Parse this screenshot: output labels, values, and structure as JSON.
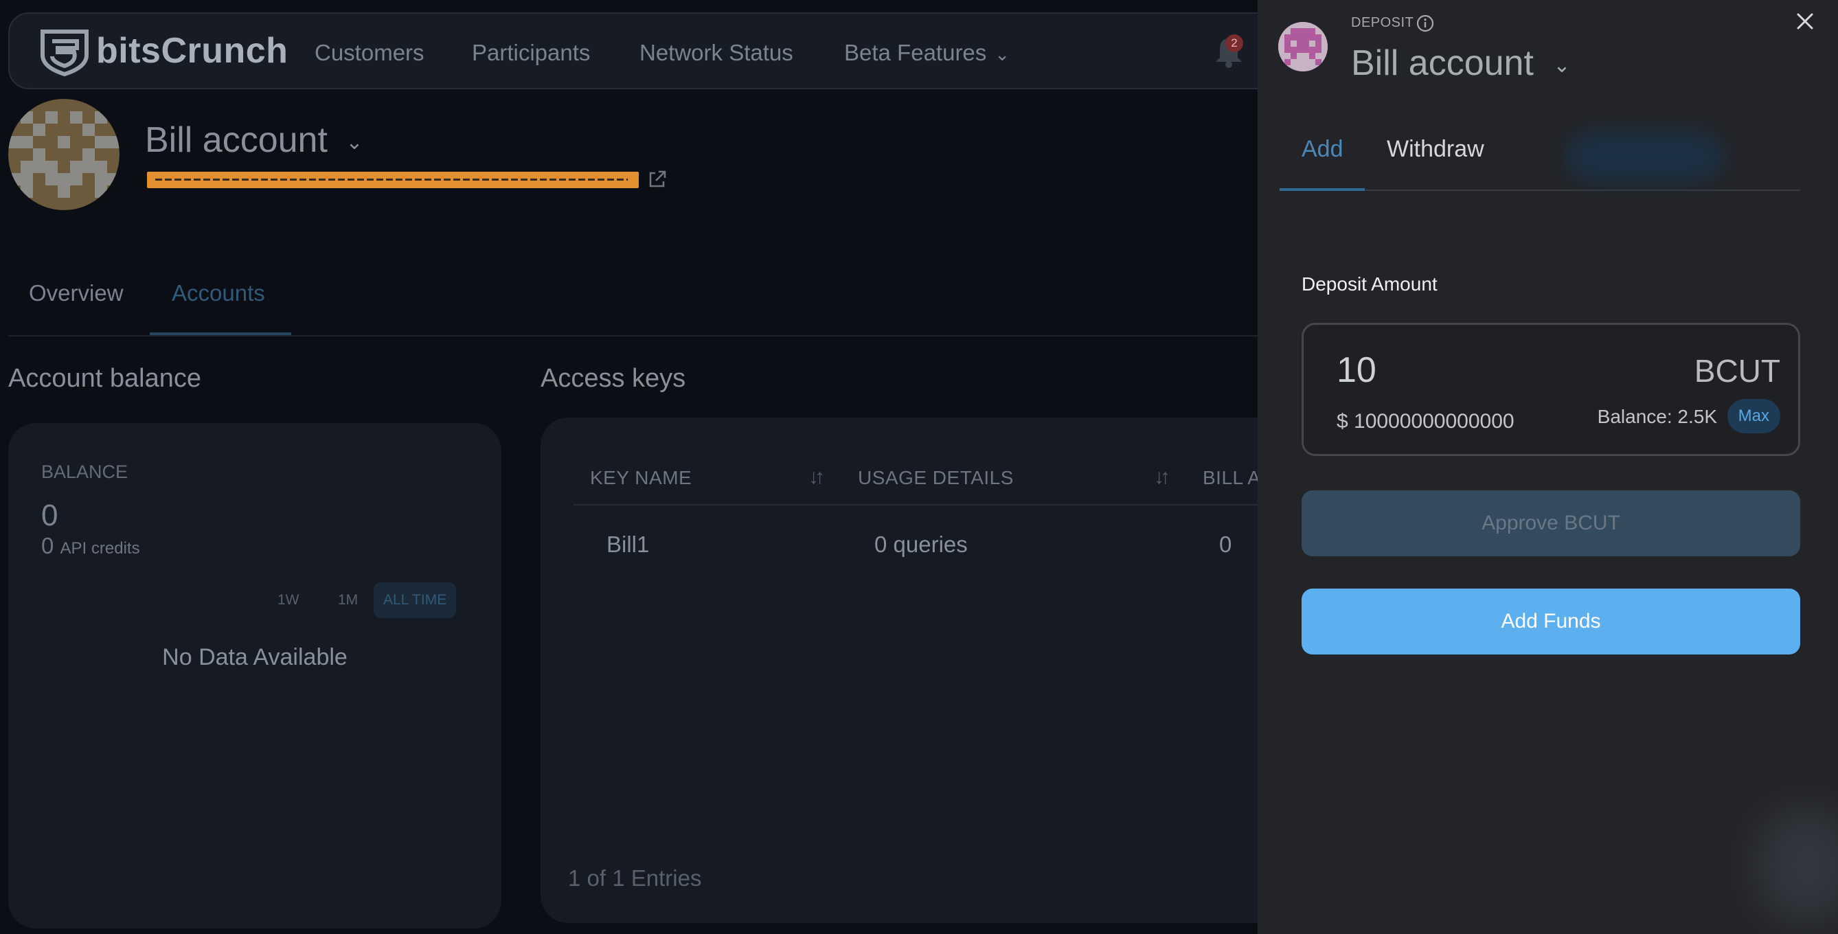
{
  "nav": {
    "brand": "bitsCrunch",
    "items": [
      "Customers",
      "Participants",
      "Network Status",
      "Beta Features"
    ],
    "notification_count": "2"
  },
  "account": {
    "name": "Bill account"
  },
  "tabs": {
    "overview": "Overview",
    "accounts": "Accounts"
  },
  "balance_section": {
    "title": "Account balance",
    "label": "BALANCE",
    "value": "0",
    "credits_value": "0",
    "credits_unit": "API credits",
    "ranges": [
      "1W",
      "1M",
      "ALL TIME"
    ],
    "active_range": "ALL TIME",
    "empty": "No Data Available"
  },
  "access_keys": {
    "title": "Access keys",
    "columns": [
      "KEY NAME",
      "USAGE DETAILS",
      "BILL A"
    ],
    "rows": [
      {
        "key_name": "Bill1",
        "usage": "0 queries",
        "bill": "0"
      }
    ],
    "entries": "1 of 1 Entries"
  },
  "drawer": {
    "label": "DEPOSIT",
    "title": "Bill account",
    "tabs": [
      "Add",
      "Withdraw"
    ],
    "active_tab": "Add",
    "amount_label": "Deposit Amount",
    "amount_value": "10",
    "token": "BCUT",
    "usd_value": "$ 10000000000000",
    "balance": "Balance: 2.5K",
    "max_label": "Max",
    "approve_label": "Approve BCUT",
    "add_funds_label": "Add Funds"
  },
  "colors": {
    "accent": "#5db0ef",
    "address_highlight": "#e2902f",
    "drawer_bg": "#232427",
    "page_bg": "#0b0e15"
  }
}
